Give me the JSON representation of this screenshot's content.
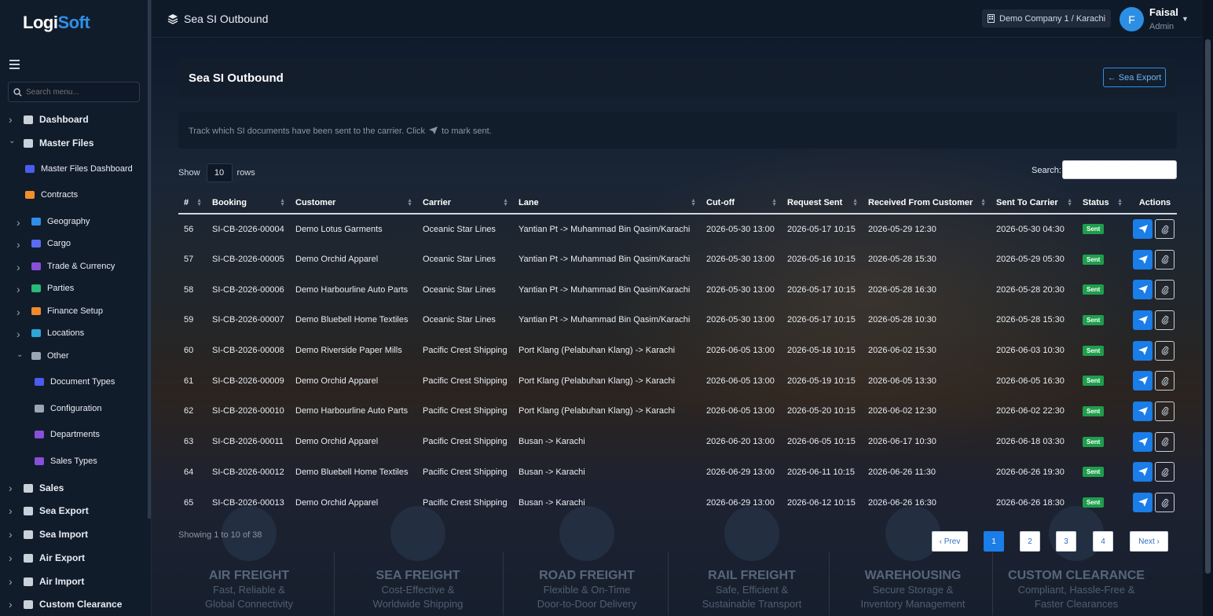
{
  "app": {
    "logo_a": "Logi",
    "logo_b": "Soft"
  },
  "sidebar": {
    "search_placeholder": "Search menu...",
    "items": [
      {
        "label": "Dashboard",
        "icon": "chart-line-icon",
        "level": "top"
      },
      {
        "label": "Master Files",
        "icon": "database-icon",
        "level": "top"
      },
      {
        "label": "Master Files Dashboard",
        "icon": "grid-icon",
        "level": "sub"
      },
      {
        "label": "Contracts",
        "icon": "file-icon",
        "level": "sub"
      },
      {
        "label": "Geography",
        "icon": "globe-icon",
        "level": "sub"
      },
      {
        "label": "Cargo",
        "icon": "box-icon",
        "level": "sub"
      },
      {
        "label": "Trade & Currency",
        "icon": "currency-icon",
        "level": "sub"
      },
      {
        "label": "Parties",
        "icon": "users-icon",
        "level": "sub"
      },
      {
        "label": "Finance Setup",
        "icon": "coins-icon",
        "level": "sub"
      },
      {
        "label": "Locations",
        "icon": "warehouse-icon",
        "level": "sub"
      },
      {
        "label": "Other",
        "icon": "tag-icon",
        "level": "sub"
      },
      {
        "label": "Document Types",
        "icon": "doc-types-icon",
        "level": "subsub"
      },
      {
        "label": "Configuration",
        "icon": "sliders-icon",
        "level": "subsub"
      },
      {
        "label": "Departments",
        "icon": "people-icon",
        "level": "subsub"
      },
      {
        "label": "Sales Types",
        "icon": "chart-icon",
        "level": "subsub"
      },
      {
        "label": "Sales",
        "icon": "handshake-icon",
        "level": "top"
      },
      {
        "label": "Sea Export",
        "icon": "anchor-icon",
        "level": "top"
      },
      {
        "label": "Sea Import",
        "icon": "ship-icon",
        "level": "top"
      },
      {
        "label": "Air Export",
        "icon": "plane-icon",
        "level": "top"
      },
      {
        "label": "Air Import",
        "icon": "plane-landing-icon",
        "level": "top"
      },
      {
        "label": "Custom Clearance",
        "icon": "building-icon",
        "level": "top"
      }
    ]
  },
  "topbar": {
    "title": "Sea SI Outbound",
    "company": "Demo Company 1 / Karachi",
    "user_initial": "F",
    "user_name": "Faisal",
    "user_role": "Admin"
  },
  "page": {
    "title": "Sea SI Outbound",
    "back_button": "Sea Export",
    "hint_before": "Track which SI documents have been sent to the carrier. Click",
    "hint_after": "to mark sent.",
    "show_label": "Show",
    "rows_value": "10",
    "rows_label": "rows",
    "search_label": "Search:",
    "showing": "Showing 1 to 10 of 38",
    "pagination": [
      "‹ Prev",
      "1",
      "2",
      "3",
      "4",
      "Next ›"
    ]
  },
  "table": {
    "headers": [
      "#",
      "Booking",
      "Customer",
      "Carrier",
      "Lane",
      "Cut-off",
      "Request Sent",
      "Received From Customer",
      "Sent To Carrier",
      "Status",
      "Actions"
    ],
    "rows": [
      [
        "56",
        "SI-CB-2026-00004",
        "Demo Lotus Garments",
        "Oceanic Star Lines",
        "Yantian Pt -> Muhammad Bin Qasim/Karachi",
        "2026-05-30 13:00",
        "2026-05-17 10:15",
        "2026-05-29 12:30",
        "2026-05-30 04:30",
        "Sent"
      ],
      [
        "57",
        "SI-CB-2026-00005",
        "Demo Orchid Apparel",
        "Oceanic Star Lines",
        "Yantian Pt -> Muhammad Bin Qasim/Karachi",
        "2026-05-30 13:00",
        "2026-05-16 10:15",
        "2026-05-28 15:30",
        "2026-05-29 05:30",
        "Sent"
      ],
      [
        "58",
        "SI-CB-2026-00006",
        "Demo Harbourline Auto Parts",
        "Oceanic Star Lines",
        "Yantian Pt -> Muhammad Bin Qasim/Karachi",
        "2026-05-30 13:00",
        "2026-05-17 10:15",
        "2026-05-28 16:30",
        "2026-05-28 20:30",
        "Sent"
      ],
      [
        "59",
        "SI-CB-2026-00007",
        "Demo Bluebell Home Textiles",
        "Oceanic Star Lines",
        "Yantian Pt -> Muhammad Bin Qasim/Karachi",
        "2026-05-30 13:00",
        "2026-05-17 10:15",
        "2026-05-28 10:30",
        "2026-05-28 15:30",
        "Sent"
      ],
      [
        "60",
        "SI-CB-2026-00008",
        "Demo Riverside Paper Mills",
        "Pacific Crest Shipping",
        "Port Klang (Pelabuhan Klang) -> Karachi",
        "2026-06-05 13:00",
        "2026-05-18 10:15",
        "2026-06-02 15:30",
        "2026-06-03 10:30",
        "Sent"
      ],
      [
        "61",
        "SI-CB-2026-00009",
        "Demo Orchid Apparel",
        "Pacific Crest Shipping",
        "Port Klang (Pelabuhan Klang) -> Karachi",
        "2026-06-05 13:00",
        "2026-05-19 10:15",
        "2026-06-05 13:30",
        "2026-06-05 16:30",
        "Sent"
      ],
      [
        "62",
        "SI-CB-2026-00010",
        "Demo Harbourline Auto Parts",
        "Pacific Crest Shipping",
        "Port Klang (Pelabuhan Klang) -> Karachi",
        "2026-06-05 13:00",
        "2026-05-20 10:15",
        "2026-06-02 12:30",
        "2026-06-02 22:30",
        "Sent"
      ],
      [
        "63",
        "SI-CB-2026-00011",
        "Demo Orchid Apparel",
        "Pacific Crest Shipping",
        "Busan -> Karachi",
        "2026-06-20 13:00",
        "2026-06-05 10:15",
        "2026-06-17 10:30",
        "2026-06-18 03:30",
        "Sent"
      ],
      [
        "64",
        "SI-CB-2026-00012",
        "Demo Bluebell Home Textiles",
        "Pacific Crest Shipping",
        "Busan -> Karachi",
        "2026-06-29 13:00",
        "2026-06-11 10:15",
        "2026-06-26 11:30",
        "2026-06-26 19:30",
        "Sent"
      ],
      [
        "65",
        "SI-CB-2026-00013",
        "Demo Orchid Apparel",
        "Pacific Crest Shipping",
        "Busan -> Karachi",
        "2026-06-29 13:00",
        "2026-06-12 10:15",
        "2026-06-26 16:30",
        "2026-06-26 18:30",
        "Sent"
      ]
    ]
  },
  "background_features": [
    {
      "title": "AIR FREIGHT",
      "l1": "Fast, Reliable &",
      "l2": "Global Connectivity"
    },
    {
      "title": "SEA FREIGHT",
      "l1": "Cost-Effective &",
      "l2": "Worldwide Shipping"
    },
    {
      "title": "ROAD FREIGHT",
      "l1": "Flexible & On-Time",
      "l2": "Door-to-Door Delivery"
    },
    {
      "title": "RAIL FREIGHT",
      "l1": "Safe, Efficient &",
      "l2": "Sustainable Transport"
    },
    {
      "title": "WAREHOUSING",
      "l1": "Secure Storage &",
      "l2": "Inventory Management"
    },
    {
      "title": "CUSTOM CLEARANCE",
      "l1": "Compliant, Hassle-Free &",
      "l2": "Faster Clearances"
    }
  ],
  "colors": {
    "accent": "#1a7de8",
    "sent_badge": "#1e9e4c",
    "sidebar_bg": "#111c2b"
  }
}
